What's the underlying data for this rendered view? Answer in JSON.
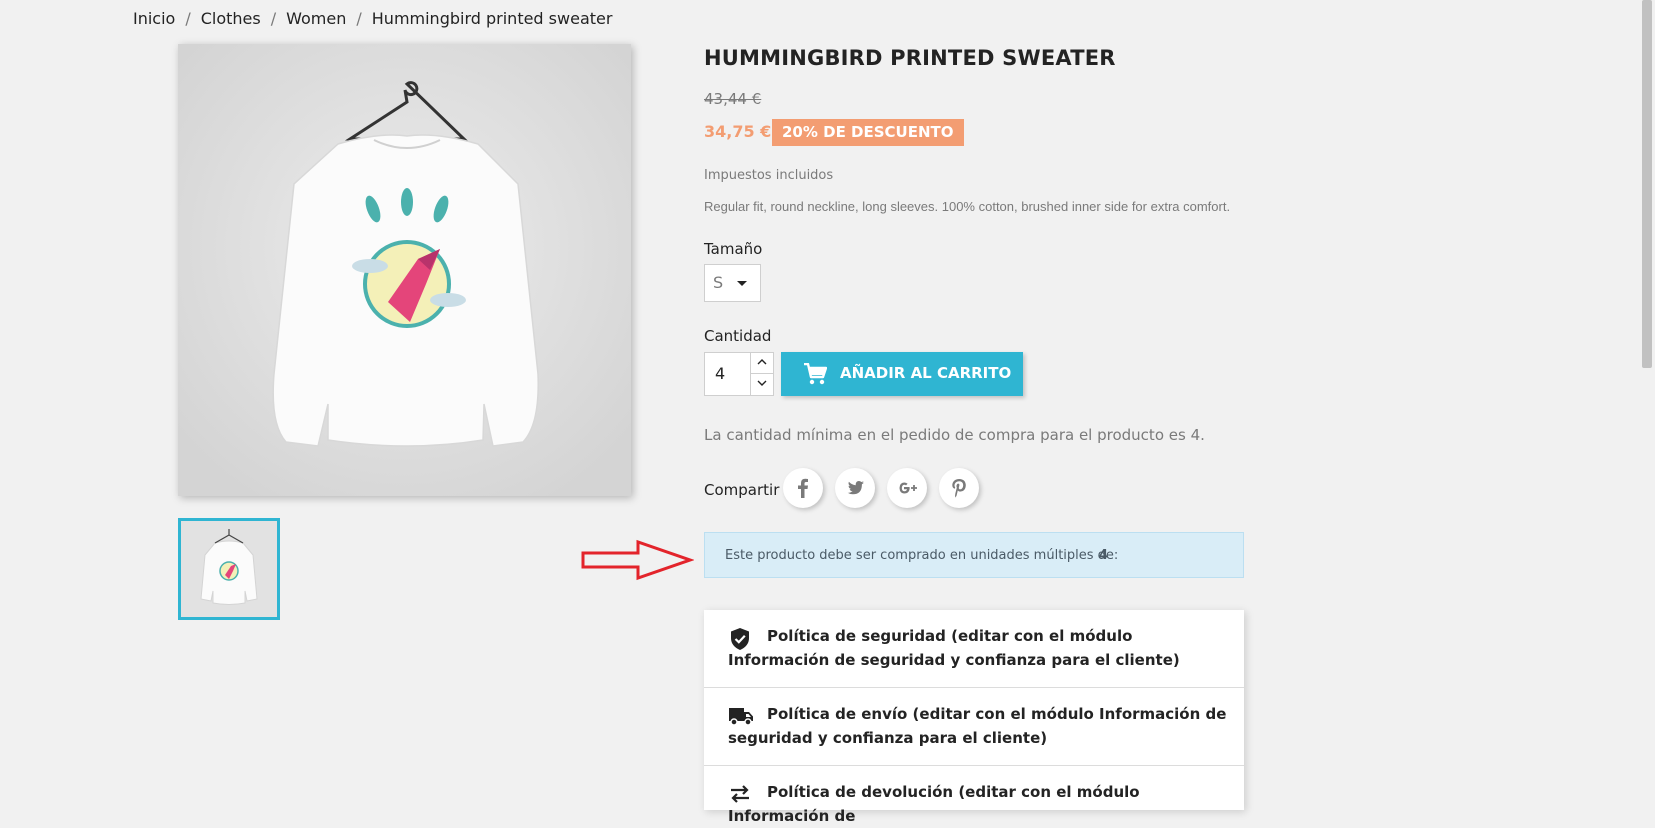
{
  "breadcrumb": [
    "Inicio",
    "Clothes",
    "Women",
    "Hummingbird printed sweater"
  ],
  "product": {
    "title": "HUMMINGBIRD PRINTED SWEATER",
    "regular_price": "43,44 €",
    "price": "34,75 €",
    "discount": "20% DE DESCUENTO",
    "tax_label": "Impuestos incluidos",
    "description": "Regular fit, round neckline, long sleeves. 100% cotton, brushed inner side for extra comfort."
  },
  "variants": {
    "size_label": "Tamaño",
    "size_value": "S"
  },
  "quantity": {
    "label": "Cantidad",
    "value": "4"
  },
  "add_to_cart": {
    "label": "AÑADIR AL CARRITO"
  },
  "min_quantity_note": "La cantidad mínima en el pedido de compra para el producto es 4.",
  "share": {
    "label": "Compartir",
    "networks": [
      "facebook-icon",
      "twitter-icon",
      "google-plus-icon",
      "pinterest-icon"
    ]
  },
  "multiples_info": {
    "text": "Este producto debe ser comprado en unidades múltiples de:",
    "value": "4"
  },
  "reassurance": [
    {
      "icon": "shield-check-icon",
      "text": "Política de seguridad (editar con el módulo Información de seguridad y confianza para el cliente)"
    },
    {
      "icon": "truck-icon",
      "text": "Política de envío (editar con el módulo Información de seguridad y confianza para el cliente)"
    },
    {
      "icon": "swap-arrows-icon",
      "text": "Política de devolución (editar con el módulo Información de"
    }
  ],
  "colors": {
    "accent": "#2fb5d2",
    "discount": "#f39d72",
    "info_bg": "#d9edf7",
    "annotation_arrow": "#e3242b"
  }
}
